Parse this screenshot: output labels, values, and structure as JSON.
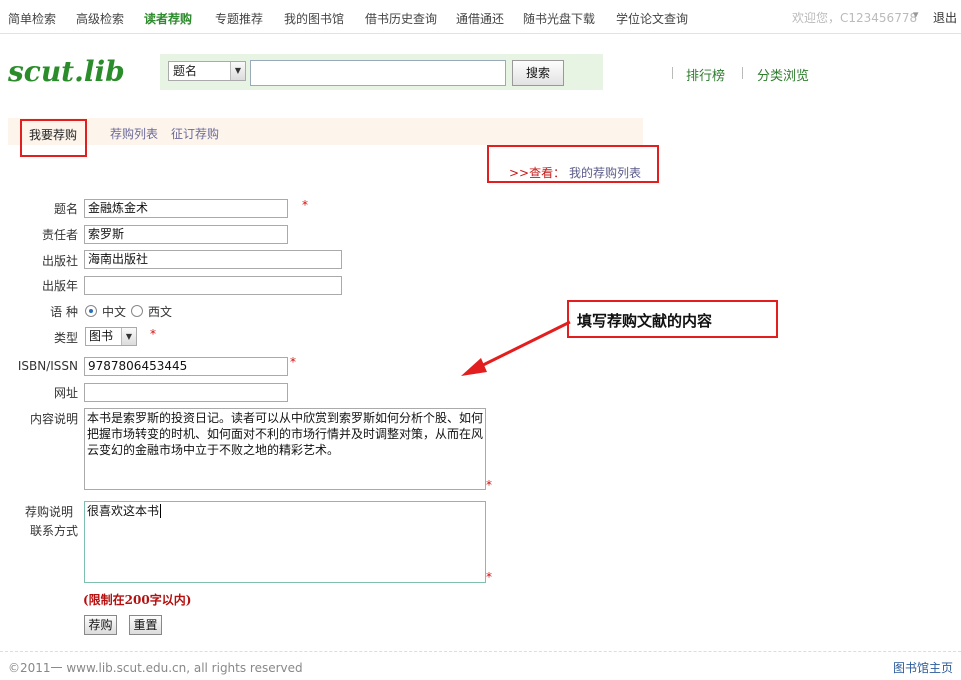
{
  "nav": {
    "items": [
      "简单检索",
      "高级检索",
      "读者荐购",
      "专题推荐",
      "我的图书馆",
      "借书历史查询",
      "通借通还",
      "随书光盘下载",
      "学位论文查询"
    ],
    "welcome": "欢迎您，C123456778",
    "logout": "退出"
  },
  "logo": "scut.lib",
  "search": {
    "field_selected": "题名",
    "button": "搜索"
  },
  "side_links": [
    "排行榜",
    "分类浏览"
  ],
  "tabs": [
    "我要荐购",
    "荐购列表",
    "征订荐购"
  ],
  "view": {
    "prefix": ">>查看：",
    "link": "我的荐购列表"
  },
  "form": {
    "title_label": "题名",
    "title_value": "金融炼金术",
    "author_label": "责任者",
    "author_value": "索罗斯",
    "publisher_label": "出版社",
    "publisher_value": "海南出版社",
    "year_label": "出版年",
    "year_value": "",
    "language_label": "语 种",
    "language_options": [
      "中文",
      "西文"
    ],
    "type_label": "类型",
    "type_value": "图书",
    "isbn_label": "ISBN/ISSN",
    "isbn_value": "9787806453445",
    "url_label": "网址",
    "url_value": "",
    "content_label": "内容说明",
    "content_value": "本书是索罗斯的投资日记。读者可以从中欣赏到索罗斯如何分析个股、如何把握市场转变的时机、如何面对不利的市场行情并及时调整对策，从而在风云变幻的金融市场中立于不败之地的精彩艺术。",
    "reason_label": "荐购说明",
    "contact_label": "联系方式",
    "reason_value": "很喜欢这本书",
    "limit_note": "(限制在200字以内)",
    "required_mark": "*",
    "submit": "荐购",
    "reset": "重置"
  },
  "callout": "填写荐购文献的内容",
  "footer": {
    "copyright": "©2011一 www.lib.scut.edu.cn, all rights reserved",
    "home_link": "图书馆主页"
  },
  "colors": {
    "brand_green": "#2b8c2b",
    "highlight_red": "#e31e1e"
  }
}
